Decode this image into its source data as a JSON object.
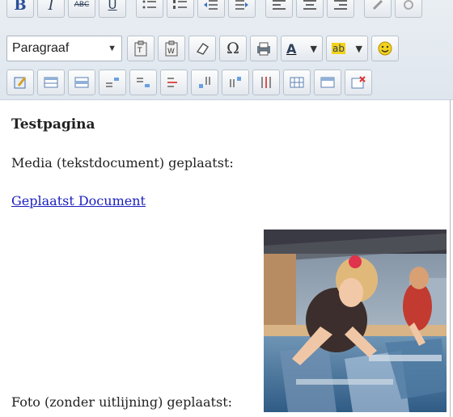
{
  "toolbar": {
    "row1": {
      "bold_label": "B",
      "italic_label": "I",
      "strike_label": "ABC",
      "underline_label": "U"
    },
    "row2": {
      "format_select_value": "Paragraaf",
      "omega_label": "Ω",
      "text_color_label": "A",
      "highlight_label": "ab"
    }
  },
  "editor": {
    "heading": "Testpagina",
    "media_text": "Media (tekstdocument) geplaatst:",
    "link_text": "Geplaatst Document",
    "photo_text": "Foto (zonder uitlijning) geplaatst:"
  },
  "colors": {
    "link": "#1a1fbf",
    "toolbar_bg": "#e3e9ef",
    "accent_yellow": "#f3d21a"
  }
}
